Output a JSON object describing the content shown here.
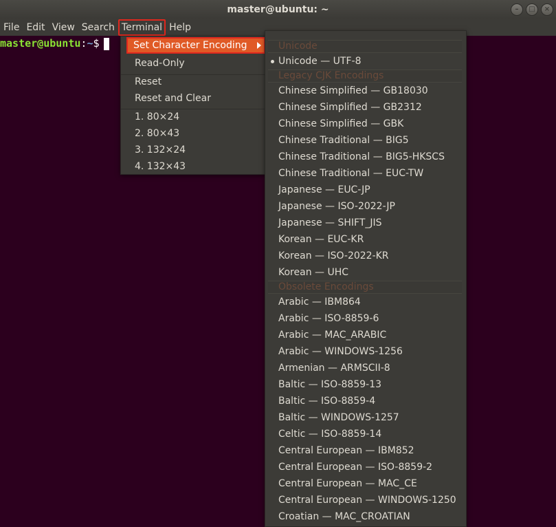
{
  "window": {
    "title": "master@ubuntu: ~",
    "controls": [
      "–",
      "□",
      "×"
    ]
  },
  "menubar": [
    "File",
    "Edit",
    "View",
    "Search",
    "Terminal",
    "Help"
  ],
  "prompt": {
    "user": "master@ubuntu",
    "colon": ":",
    "path": "~",
    "sign": "$"
  },
  "terminal_menu": {
    "items": [
      "Set Character Encoding",
      "Read-Only",
      "Reset",
      "Reset and Clear",
      "1. 80×24",
      "2. 80×43",
      "3. 132×24",
      "4. 132×43"
    ]
  },
  "encoding_menu": {
    "headers": [
      "Unicode",
      "Legacy CJK Encodings",
      "Obsolete Encodings"
    ],
    "unicode": [
      "Unicode — UTF-8"
    ],
    "cjk": [
      "Chinese Simplified — GB18030",
      "Chinese Simplified — GB2312",
      "Chinese Simplified — GBK",
      "Chinese Traditional — BIG5",
      "Chinese Traditional — BIG5-HKSCS",
      "Chinese Traditional — EUC-TW",
      "Japanese — EUC-JP",
      "Japanese — ISO-2022-JP",
      "Japanese — SHIFT_JIS",
      "Korean — EUC-KR",
      "Korean — ISO-2022-KR",
      "Korean — UHC"
    ],
    "obsolete": [
      "Arabic — IBM864",
      "Arabic — ISO-8859-6",
      "Arabic — MAC_ARABIC",
      "Arabic — WINDOWS-1256",
      "Armenian — ARMSCII-8",
      "Baltic — ISO-8859-13",
      "Baltic — ISO-8859-4",
      "Baltic — WINDOWS-1257",
      "Celtic — ISO-8859-14",
      "Central European — IBM852",
      "Central European — ISO-8859-2",
      "Central European — MAC_CE",
      "Central European — WINDOWS-1250",
      "Croatian — MAC_CROATIAN"
    ]
  }
}
